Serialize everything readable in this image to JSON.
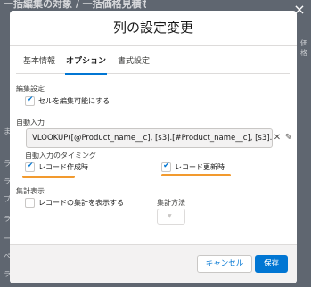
{
  "background": {
    "title": "一括編集の対象 / 一括価格見積もり",
    "side_chars": [
      "ま",
      "ラ",
      "ラ",
      "プ",
      "ラ",
      "ー",
      "ペ",
      "ラ"
    ],
    "right_text": "価格"
  },
  "modal": {
    "title": "列の設定変更",
    "tabs": [
      {
        "label": "基本情報"
      },
      {
        "label": "オプション"
      },
      {
        "label": "書式設定"
      }
    ],
    "active_tab": "オプション",
    "edit_section": {
      "heading": "編集設定",
      "checkbox_label": "セルを編集可能にする",
      "checked": true
    },
    "auto_input": {
      "heading": "自動入力",
      "formula": "VLOOKUP([@Product_name__c], [s3].[#Product_name__c], [s3].[#",
      "timing_label": "自動入力のタイミング",
      "on_create_label": "レコード作成時",
      "on_create_checked": true,
      "on_update_label": "レコード更新時",
      "on_update_checked": true
    },
    "aggregate": {
      "heading": "集計表示",
      "checkbox_label": "レコードの集計を表示する",
      "checked": false,
      "method_label": "集計方法",
      "method_value": ""
    },
    "footer": {
      "cancel_label": "キャンセル",
      "save_label": "保存"
    }
  },
  "icons": {
    "check": "✔",
    "clear": "✕",
    "edit": "✎",
    "dropdown": "▼",
    "close": "×"
  },
  "colors": {
    "brand": "#0176d3",
    "annotation": "#f29a2e"
  }
}
